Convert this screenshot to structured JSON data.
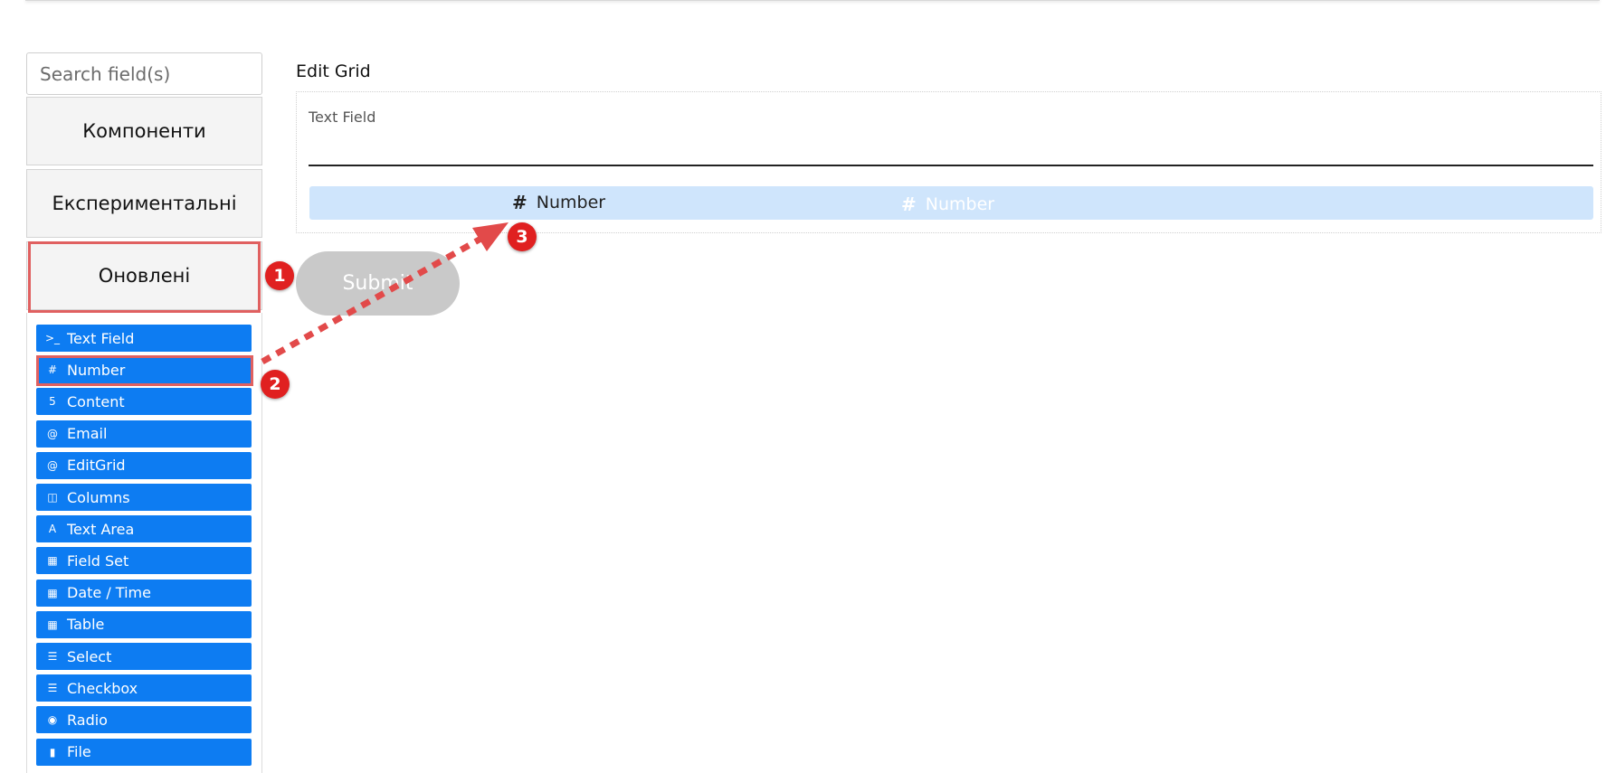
{
  "search": {
    "placeholder": "Search field(s)"
  },
  "groups": [
    {
      "label": "Компоненти"
    },
    {
      "label": "Експериментальні"
    },
    {
      "label": "Оновлені"
    }
  ],
  "components": [
    {
      "label": "Text Field",
      "icon": "terminal-icon",
      "glyph": ">_"
    },
    {
      "label": "Number",
      "icon": "hash-icon",
      "glyph": "#"
    },
    {
      "label": "Content",
      "icon": "html5-icon",
      "glyph": "5"
    },
    {
      "label": "Email",
      "icon": "at-icon",
      "glyph": "@"
    },
    {
      "label": "EditGrid",
      "icon": "at-icon",
      "glyph": "@"
    },
    {
      "label": "Columns",
      "icon": "columns-icon",
      "glyph": "◫"
    },
    {
      "label": "Text Area",
      "icon": "font-icon",
      "glyph": "A"
    },
    {
      "label": "Field Set",
      "icon": "grid-icon",
      "glyph": "▦"
    },
    {
      "label": "Date / Time",
      "icon": "calendar-icon",
      "glyph": "▦"
    },
    {
      "label": "Table",
      "icon": "table-icon",
      "glyph": "▦"
    },
    {
      "label": "Select",
      "icon": "list-icon",
      "glyph": "☰"
    },
    {
      "label": "Checkbox",
      "icon": "list-icon",
      "glyph": "☰"
    },
    {
      "label": "Radio",
      "icon": "dot-circle-icon",
      "glyph": "◉"
    },
    {
      "label": "File",
      "icon": "file-icon",
      "glyph": "▮"
    }
  ],
  "main": {
    "grid_title": "Edit Grid",
    "text_field_label": "Text Field",
    "dragged_component": "Number",
    "ghost_component": "Number",
    "submit_label": "Submit"
  },
  "markers": [
    "1",
    "2",
    "3"
  ],
  "colors": {
    "component_bg": "#0d7cf2",
    "drop_zone_bg": "#cfe5fc",
    "highlight": "#e06060",
    "marker": "#e02020"
  }
}
